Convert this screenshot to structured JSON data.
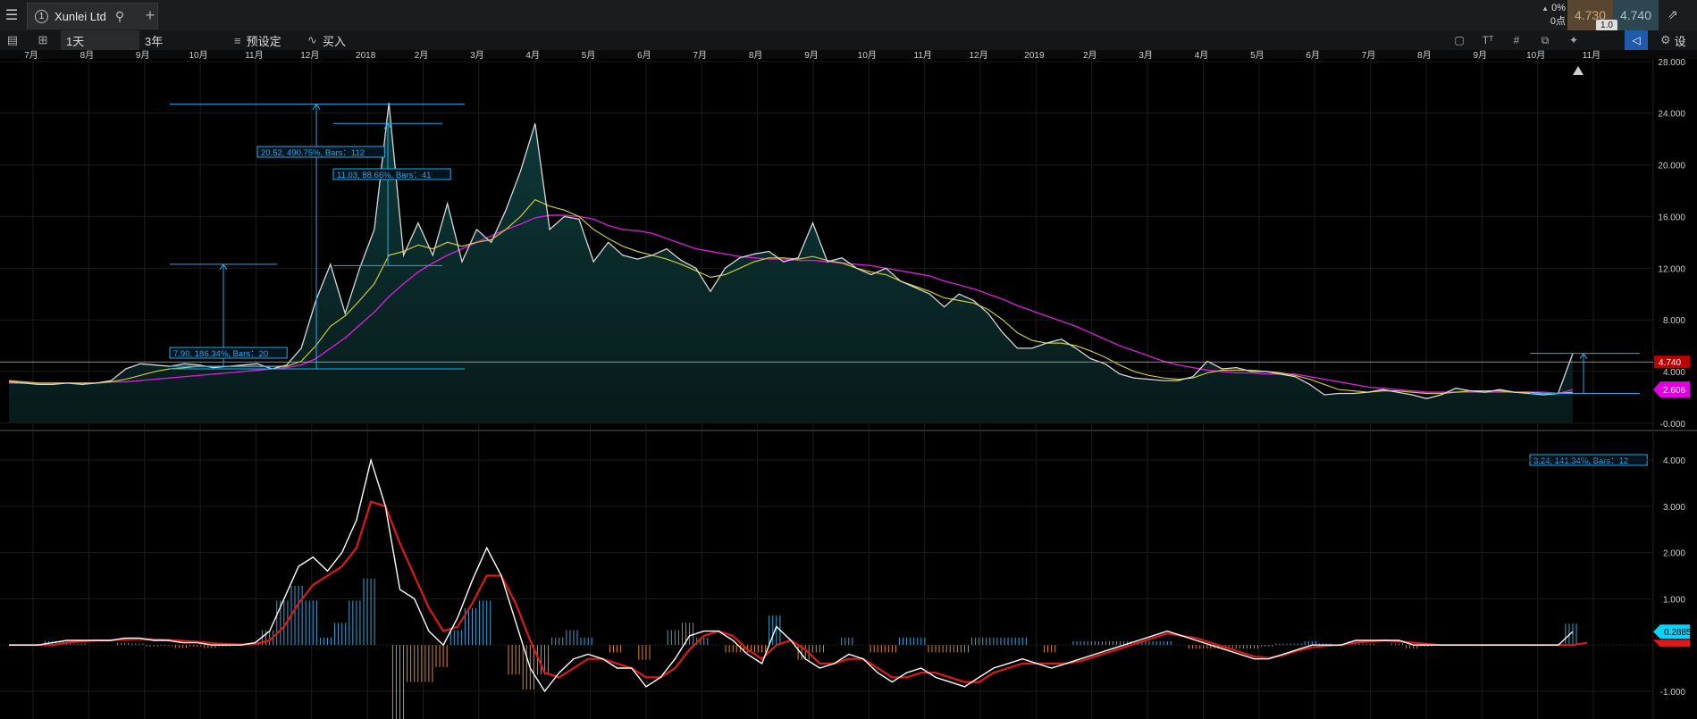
{
  "topbar": {
    "tab_number": "1",
    "tab_title": "Xunlei Ltd",
    "change_pct": "0%",
    "change_pts": "0点",
    "bid": "4.730",
    "ask": "4.740",
    "spread": "1.0"
  },
  "toolbar": {
    "interval": "1天",
    "range": "3年",
    "preset_label": "预设定",
    "buy_label": "买入",
    "settings_label": "设"
  },
  "colors": {
    "price_line": "#d8d8d8",
    "area_fill": "#0d3a3a",
    "ma_short": "#c9c934",
    "ma_long": "#d21fd2",
    "measure": "#27a9e6",
    "macd_line": "#ffffff",
    "signal_line": "#e01818",
    "hist_pos": "#3aa6d8",
    "hist_neg": "#d98a2b",
    "last_price_badge": "#c00000",
    "ma_badge": "#e000e0",
    "macd_badge": "#00d4ff"
  },
  "chart_data": [
    {
      "type": "area",
      "x_ticks": [
        "7月",
        "8月",
        "9月",
        "10月",
        "11月",
        "12月",
        "2018",
        "2月",
        "3月",
        "4月",
        "5月",
        "6月",
        "7月",
        "8月",
        "9月",
        "10月",
        "11月",
        "12月",
        "2019",
        "2月",
        "3月",
        "4月",
        "5月",
        "6月",
        "7月",
        "8月",
        "9月",
        "10月",
        "11月"
      ],
      "y_ticks": [
        "28.000",
        "24.000",
        "20.000",
        "16.000",
        "12.000",
        "8.000",
        "4.000",
        "-0.000"
      ],
      "ylim": [
        -0.5,
        28.2
      ],
      "series": [
        {
          "values": [
            3.2,
            3.1,
            3.0,
            3.0,
            3.1,
            3.0,
            3.1,
            3.3,
            4.2,
            4.6,
            4.5,
            4.4,
            4.6,
            4.5,
            4.3,
            4.4,
            4.5,
            4.6,
            4.2,
            4.5,
            5.8,
            9.5,
            12.3,
            8.5,
            12.0,
            15.0,
            24.8,
            13.0,
            15.5,
            13.0,
            17.0,
            12.5,
            15.0,
            14.0,
            16.5,
            19.5,
            23.2,
            15.0,
            16.0,
            15.8,
            12.5,
            14.0,
            13.0,
            12.7,
            13.0,
            13.5,
            12.6,
            12.0,
            10.2,
            12.0,
            12.8,
            13.1,
            13.3,
            12.5,
            12.8,
            15.5,
            12.5,
            12.8,
            12.0,
            11.5,
            12.0,
            11.0,
            10.5,
            10.0,
            9.0,
            10.0,
            9.5,
            8.5,
            7.0,
            5.8,
            5.8,
            6.2,
            6.5,
            5.8,
            5.0,
            4.6,
            3.8,
            3.5,
            3.4,
            3.3,
            3.3,
            3.6,
            4.8,
            4.2,
            4.3,
            4.0,
            4.0,
            3.8,
            3.6,
            3.0,
            2.2,
            2.3,
            2.3,
            2.4,
            2.6,
            2.4,
            2.2,
            1.9,
            2.2,
            2.7,
            2.5,
            2.4,
            2.6,
            2.4,
            2.3,
            2.2,
            2.3,
            5.4
          ]
        },
        {
          "name": "",
          "values": [
            3.3,
            3.2,
            3.1,
            3.1,
            3.1,
            3.1,
            3.1,
            3.2,
            3.4,
            3.7,
            4.0,
            4.2,
            4.3,
            4.4,
            4.4,
            4.4,
            4.4,
            4.4,
            4.4,
            4.4,
            4.8,
            6.0,
            7.5,
            8.3,
            9.5,
            10.8,
            13.0,
            13.3,
            13.8,
            13.5,
            14.0,
            13.7,
            14.0,
            14.2,
            15.0,
            16.0,
            17.3,
            16.8,
            16.5,
            16.0,
            15.0,
            14.3,
            13.7,
            13.3,
            13.0,
            12.7,
            12.3,
            11.8,
            11.3,
            11.5,
            12.0,
            12.5,
            12.8,
            12.8,
            12.7,
            12.9,
            12.6,
            12.4,
            12.0,
            11.7,
            11.5,
            11.0,
            10.6,
            10.2,
            9.7,
            9.5,
            9.3,
            8.8,
            8.0,
            7.0,
            6.4,
            6.2,
            6.2,
            6.0,
            5.6,
            5.1,
            4.5,
            4.0,
            3.7,
            3.5,
            3.4,
            3.5,
            3.9,
            4.1,
            4.1,
            4.1,
            4.0,
            3.9,
            3.7,
            3.4,
            3.0,
            2.6,
            2.5,
            2.4,
            2.5,
            2.5,
            2.4,
            2.3,
            2.3,
            2.4,
            2.5,
            2.5,
            2.5,
            2.4,
            2.4,
            2.3,
            2.3,
            2.4
          ]
        },
        {
          "name": "",
          "values": [
            3.1,
            3.1,
            3.1,
            3.1,
            3.1,
            3.1,
            3.1,
            3.2,
            3.2,
            3.3,
            3.4,
            3.5,
            3.6,
            3.7,
            3.8,
            3.9,
            4.0,
            4.1,
            4.2,
            4.3,
            4.5,
            5.0,
            5.8,
            6.6,
            7.6,
            8.6,
            9.8,
            10.8,
            11.7,
            12.4,
            13.0,
            13.5,
            14.0,
            14.5,
            15.0,
            15.4,
            15.9,
            16.1,
            16.1,
            16.0,
            15.8,
            15.3,
            15.0,
            14.9,
            14.7,
            14.3,
            13.9,
            13.5,
            13.3,
            13.1,
            12.9,
            12.8,
            12.7,
            12.7,
            12.6,
            12.6,
            12.5,
            12.4,
            12.3,
            12.2,
            12.0,
            11.8,
            11.6,
            11.4,
            11.0,
            10.7,
            10.4,
            10.0,
            9.6,
            9.1,
            8.7,
            8.3,
            7.9,
            7.5,
            7.0,
            6.5,
            6.0,
            5.6,
            5.2,
            4.8,
            4.5,
            4.3,
            4.1,
            4.0,
            3.9,
            3.9,
            3.8,
            3.8,
            3.8,
            3.6,
            3.4,
            3.2,
            3.0,
            2.8,
            2.7,
            2.6,
            2.5,
            2.4,
            2.4,
            2.4,
            2.4,
            2.4,
            2.4,
            2.4,
            2.4,
            2.4,
            2.3,
            2.6
          ]
        }
      ],
      "annotations": [
        "20.52, 490.75%, Bars：112",
        "11.03, 88.66%, Bars：41",
        "7.90, 186.34%, Bars：20",
        "3.24, 141.34%, Bars：12"
      ],
      "last_price_label": "4.740",
      "ma_label": "2.606",
      "grid": true,
      "legend": "none"
    },
    {
      "type": "line",
      "y_ticks": [
        "4.000",
        "3.000",
        "2.000",
        "1.000",
        "-1.000"
      ],
      "ylim": [
        -1.6,
        4.6
      ],
      "series": [
        {
          "values": [
            0.0,
            0.0,
            0.0,
            0.05,
            0.1,
            0.1,
            0.1,
            0.1,
            0.15,
            0.15,
            0.1,
            0.1,
            0.05,
            0.05,
            0.0,
            0.0,
            0.0,
            0.05,
            0.3,
            1.0,
            1.7,
            1.9,
            1.6,
            2.0,
            2.7,
            4.0,
            3.0,
            1.2,
            1.0,
            0.3,
            0.0,
            0.6,
            1.4,
            2.1,
            1.5,
            0.5,
            -0.5,
            -1.0,
            -0.6,
            -0.3,
            -0.2,
            -0.3,
            -0.5,
            -0.5,
            -0.9,
            -0.7,
            -0.3,
            0.2,
            0.3,
            0.3,
            0.1,
            -0.2,
            -0.4,
            0.4,
            0.1,
            -0.3,
            -0.5,
            -0.4,
            -0.2,
            -0.3,
            -0.6,
            -0.8,
            -0.6,
            -0.5,
            -0.7,
            -0.8,
            -0.9,
            -0.7,
            -0.5,
            -0.4,
            -0.3,
            -0.4,
            -0.5,
            -0.4,
            -0.3,
            -0.2,
            -0.1,
            0.0,
            0.1,
            0.2,
            0.3,
            0.2,
            0.1,
            0.0,
            -0.1,
            -0.2,
            -0.3,
            -0.3,
            -0.2,
            -0.1,
            0.0,
            0.0,
            0.0,
            0.1,
            0.1,
            0.1,
            0.1,
            0.0,
            0.0,
            0.0,
            0.0,
            0.0,
            0.0,
            0.0,
            0.0,
            0.0,
            0.0,
            0.0,
            0.29
          ]
        },
        {
          "values": [
            0.0,
            0.0,
            0.0,
            0.0,
            0.05,
            0.08,
            0.1,
            0.1,
            0.12,
            0.13,
            0.12,
            0.11,
            0.09,
            0.07,
            0.04,
            0.02,
            0.01,
            0.02,
            0.1,
            0.4,
            0.9,
            1.3,
            1.5,
            1.7,
            2.1,
            3.1,
            3.0,
            2.2,
            1.5,
            0.8,
            0.3,
            0.4,
            0.9,
            1.5,
            1.5,
            0.9,
            0.1,
            -0.6,
            -0.7,
            -0.5,
            -0.3,
            -0.3,
            -0.4,
            -0.5,
            -0.7,
            -0.7,
            -0.5,
            -0.1,
            0.2,
            0.3,
            0.2,
            -0.1,
            -0.3,
            0.0,
            0.1,
            -0.1,
            -0.4,
            -0.4,
            -0.3,
            -0.3,
            -0.5,
            -0.7,
            -0.7,
            -0.6,
            -0.6,
            -0.7,
            -0.8,
            -0.8,
            -0.6,
            -0.5,
            -0.4,
            -0.4,
            -0.4,
            -0.4,
            -0.35,
            -0.25,
            -0.15,
            -0.05,
            0.05,
            0.15,
            0.25,
            0.2,
            0.15,
            0.05,
            -0.05,
            -0.15,
            -0.25,
            -0.28,
            -0.22,
            -0.12,
            -0.05,
            -0.02,
            0.0,
            0.05,
            0.08,
            0.1,
            0.08,
            0.05,
            0.02,
            0.0,
            0.0,
            0.0,
            0.0,
            0.0,
            0.0,
            0.0,
            0.0,
            0.0,
            0.0,
            0.05
          ]
        }
      ],
      "last_value_label": "0.2885"
    }
  ]
}
